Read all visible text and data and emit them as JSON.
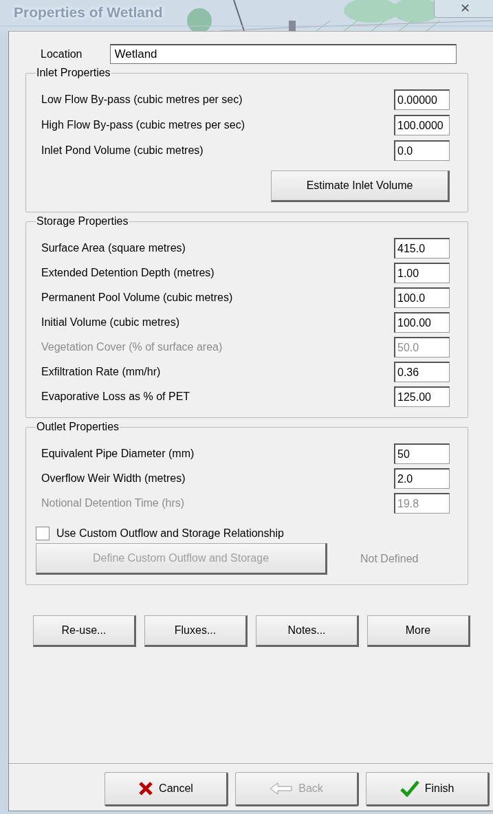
{
  "window": {
    "title": "Properties of Wetland",
    "close": "✕"
  },
  "location": {
    "label": "Location",
    "value": "Wetland"
  },
  "groups": [
    {
      "title": "Inlet Properties",
      "fields": [
        {
          "label": "Low Flow By-pass (cubic metres per sec)",
          "value": "0.00000",
          "disabled": false
        },
        {
          "label": "High Flow By-pass (cubic metres per sec)",
          "value": "100.0000",
          "disabled": false
        },
        {
          "label": "Inlet Pond Volume (cubic metres)",
          "value": "0.0",
          "disabled": false
        }
      ],
      "button": {
        "label": "Estimate Inlet Volume",
        "disabled": false
      }
    },
    {
      "title": "Storage Properties",
      "fields": [
        {
          "label": "Surface Area (square metres)",
          "value": "415.0",
          "disabled": false
        },
        {
          "label": "Extended Detention Depth (metres)",
          "value": "1.00",
          "disabled": false
        },
        {
          "label": "Permanent Pool Volume (cubic metres)",
          "value": "100.0",
          "disabled": false
        },
        {
          "label": "Initial Volume (cubic metres)",
          "value": "100.00",
          "disabled": false
        },
        {
          "label": "Vegetation Cover (% of surface area)",
          "value": "50.0",
          "disabled": true
        },
        {
          "label": "Exfiltration Rate (mm/hr)",
          "value": "0.36",
          "disabled": false
        },
        {
          "label": "Evaporative Loss as % of PET",
          "value": "125.00",
          "disabled": false
        }
      ]
    },
    {
      "title": "Outlet Properties",
      "fields": [
        {
          "label": "Equivalent Pipe Diameter (mm)",
          "value": "50",
          "disabled": false
        },
        {
          "label": "Overflow Weir Width (metres)",
          "value": "2.0",
          "disabled": false
        },
        {
          "label": "Notional Detention Time (hrs)",
          "value": "19.8",
          "disabled": true
        }
      ],
      "checkbox": {
        "label": "Use Custom Outflow and Storage Relationship",
        "checked": false
      },
      "custom": {
        "button": "Define Custom Outflow and Storage",
        "disabled": true,
        "status": "Not Defined"
      }
    }
  ],
  "actions": [
    "Re-use...",
    "Fluxes...",
    "Notes...",
    "More"
  ],
  "footer": [
    {
      "label": "Cancel",
      "kind": "cancel",
      "disabled": false
    },
    {
      "label": "Back",
      "kind": "back",
      "disabled": true
    },
    {
      "label": "Finish",
      "kind": "finish",
      "disabled": false
    }
  ]
}
